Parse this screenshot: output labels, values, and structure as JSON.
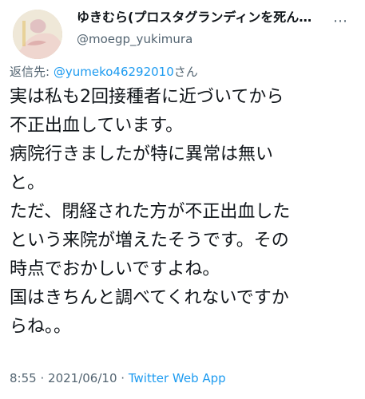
{
  "tweet": {
    "display_name": "ゆきむら(プロスタグランディンを死ん…",
    "handle": "@moegp_yukimura",
    "more_icon": "more-horizontal-icon",
    "reply_prefix": "返信先:",
    "reply_mention": "@yumeko46292010",
    "reply_suffix": "さん",
    "body_lines": [
      "実は私も2回接種者に近づいてから",
      "不正出血しています。",
      "病院行きましたが特に異常は無い",
      "と。",
      "ただ、閉経された方が不正出血した",
      "という来院が増えたそうです。その",
      "時点でおかしいですよね。",
      "国はきちんと調べてくれないですか",
      "らね。。"
    ],
    "time": "8:55",
    "separator": "·",
    "date": "2021/06/10",
    "source": "Twitter Web App"
  },
  "colors": {
    "text": "#0f1419",
    "secondary": "#536471",
    "accent": "#1d9bf0"
  }
}
